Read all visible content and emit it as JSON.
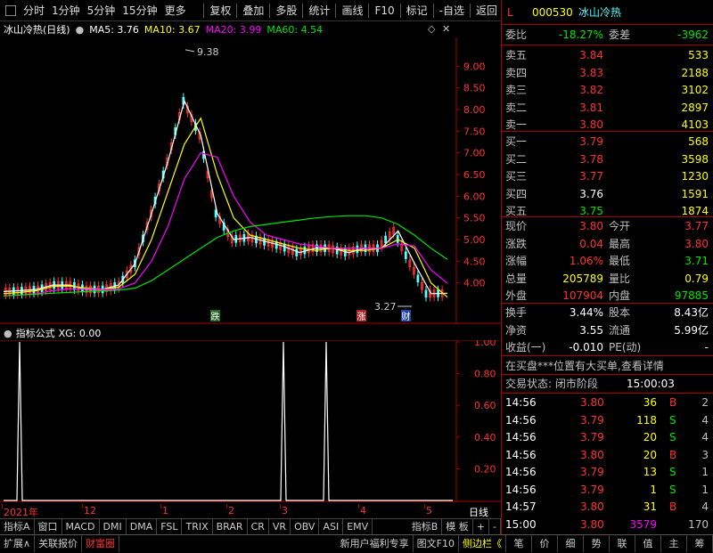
{
  "toolbar": {
    "left": [
      "分时",
      "1分钟",
      "5分钟",
      "15分钟",
      "更多"
    ],
    "right": [
      "复权",
      "叠加",
      "多股",
      "统计",
      "画线",
      "F10",
      "标记",
      "-自选",
      "返回"
    ]
  },
  "chart": {
    "title": "冰山冷热(日线)",
    "ma5_label": "MA5: 3.76",
    "ma10_label": "MA10: 3.67",
    "ma20_label": "MA20: 3.99",
    "ma60_label": "MA60: 4.54",
    "high_label": "9.38",
    "low_label": "3.27",
    "y_ticks": [
      "9.00",
      "8.50",
      "8.00",
      "7.50",
      "7.00",
      "6.50",
      "6.00",
      "5.50",
      "5.00",
      "4.50",
      "4.00"
    ],
    "marker_die": "跌",
    "marker_zhang": "涨",
    "marker_cai": "财",
    "colors": {
      "ma5": "#ffffff",
      "ma10": "#ffff00",
      "ma20": "#ff00ff",
      "ma60": "#00e600",
      "up": "#ff3232",
      "down": "#54ffff"
    }
  },
  "chart_data": {
    "type": "line",
    "title": "冰山冷热(日线)",
    "y_axis_range": [
      3.5,
      9.5
    ],
    "x_ticks": [
      "2021年",
      "12",
      "1",
      "2",
      "3",
      "4",
      "5"
    ],
    "series": [
      {
        "name": "MA5",
        "values": [
          3.8,
          3.82,
          3.85,
          3.95,
          3.95,
          3.85,
          3.85,
          3.95,
          4.45,
          5.6,
          6.8,
          8.2,
          7.4,
          5.6,
          5.0,
          5.05,
          4.95,
          4.85,
          4.7,
          4.8,
          4.8,
          4.7,
          4.8,
          4.8,
          5.2,
          4.45,
          3.75,
          3.76
        ]
      },
      {
        "name": "MA10",
        "values": [
          3.75,
          3.78,
          3.82,
          3.92,
          3.93,
          3.88,
          3.85,
          3.9,
          4.2,
          5.0,
          6.1,
          7.2,
          7.8,
          6.5,
          5.5,
          5.1,
          5.0,
          4.9,
          4.8,
          4.75,
          4.8,
          4.75,
          4.75,
          4.8,
          5.0,
          4.8,
          4.0,
          3.67
        ]
      },
      {
        "name": "MA20",
        "values": [
          3.7,
          3.72,
          3.75,
          3.82,
          3.86,
          3.86,
          3.85,
          3.86,
          4.0,
          4.5,
          5.3,
          6.4,
          7.0,
          6.9,
          6.0,
          5.4,
          5.1,
          5.0,
          4.9,
          4.85,
          4.8,
          4.8,
          4.8,
          4.8,
          4.9,
          4.85,
          4.3,
          3.99
        ]
      },
      {
        "name": "MA60",
        "values": [
          3.7,
          3.72,
          3.74,
          3.76,
          3.78,
          3.8,
          3.82,
          3.83,
          3.88,
          4.05,
          4.3,
          4.55,
          4.8,
          5.05,
          5.2,
          5.3,
          5.35,
          5.4,
          5.45,
          5.5,
          5.53,
          5.55,
          5.55,
          5.5,
          5.35,
          5.1,
          4.8,
          4.54
        ]
      }
    ]
  },
  "indicator": {
    "title": "指标公式",
    "xg_label": "XG: 0.00",
    "y_ticks": [
      "1.00",
      "0.80",
      "0.60",
      "0.40",
      "0.20"
    ]
  },
  "indicator_data": {
    "type": "line",
    "y_axis_range": [
      0,
      1
    ],
    "signals": [
      0,
      1,
      0,
      0,
      0,
      0,
      0,
      0,
      0,
      0,
      0,
      0,
      0,
      0,
      0,
      0,
      0,
      0,
      0,
      0,
      1,
      0,
      1,
      0,
      0,
      0,
      0,
      0
    ]
  },
  "xaxis": {
    "labels": [
      "2021年",
      "12",
      "1",
      "2",
      "3",
      "4",
      "5"
    ],
    "right": "日线"
  },
  "tabs": [
    "指标A",
    "窗口",
    "MACD",
    "DMI",
    "DMA",
    "FSL",
    "TRIX",
    "BRAR",
    "CR",
    "VR",
    "OBV",
    "ASI",
    "EMV",
    "指标B",
    "模 板",
    "+",
    "-"
  ],
  "bottombar": {
    "left": [
      "扩展∧",
      "关联报价",
      "财富圈"
    ],
    "mid": [
      "新用户福利专享",
      "图文F10",
      "侧边栏《"
    ],
    "right": [
      "笔",
      "价",
      "细",
      "势",
      "联",
      "值",
      "主",
      "筹"
    ]
  },
  "quote": {
    "mark": "L",
    "code": "000530",
    "name": "冰山冷热",
    "weibi_label": "委比",
    "weibi": "-18.27%",
    "weicha_label": "委差",
    "weicha": "-3962",
    "asks": [
      {
        "label": "卖五",
        "price": "3.84",
        "vol": "533"
      },
      {
        "label": "卖四",
        "price": "3.83",
        "vol": "2188"
      },
      {
        "label": "卖三",
        "price": "3.82",
        "vol": "3102"
      },
      {
        "label": "卖二",
        "price": "3.81",
        "vol": "2897"
      },
      {
        "label": "卖一",
        "price": "3.80",
        "vol": "4103"
      }
    ],
    "bids": [
      {
        "label": "买一",
        "price": "3.79",
        "vol": "568"
      },
      {
        "label": "买二",
        "price": "3.78",
        "vol": "3598"
      },
      {
        "label": "买三",
        "price": "3.77",
        "vol": "1230"
      },
      {
        "label": "买四",
        "price": "3.76",
        "vol": "1591"
      },
      {
        "label": "买五",
        "price": "3.75",
        "vol": "1874"
      }
    ],
    "stats": [
      {
        "l1": "现价",
        "v1": "3.80",
        "c1": "red",
        "l2": "今开",
        "v2": "3.77",
        "c2": "red"
      },
      {
        "l1": "涨跌",
        "v1": "0.04",
        "c1": "red",
        "l2": "最高",
        "v2": "3.80",
        "c2": "red"
      },
      {
        "l1": "涨幅",
        "v1": "1.06%",
        "c1": "red",
        "l2": "最低",
        "v2": "3.71",
        "c2": "green"
      },
      {
        "l1": "总量",
        "v1": "205789",
        "c1": "yellow",
        "l2": "量比",
        "v2": "0.79",
        "c2": "yellow"
      },
      {
        "l1": "外盘",
        "v1": "107904",
        "c1": "red",
        "l2": "内盘",
        "v2": "97885",
        "c2": "green"
      }
    ],
    "fund": [
      {
        "l1": "换手",
        "v1": "3.44%",
        "l2": "股本",
        "v2": "8.43亿"
      },
      {
        "l1": "净资",
        "v1": "3.55",
        "l2": "流通",
        "v2": "5.99亿"
      },
      {
        "l1": "收益(一)",
        "v1": "-0.010",
        "l2": "PE(动)",
        "v2": "-"
      }
    ],
    "notice": "在买盘***位置有大买单,查看详情",
    "status_label": "交易状态: 闭市阶段",
    "status_time": "15:00:03",
    "trades": [
      {
        "time": "14:56",
        "price": "3.80",
        "pc": "red",
        "vol": "36",
        "bs": "B",
        "bc": "red",
        "n": "2"
      },
      {
        "time": "14:56",
        "price": "3.79",
        "pc": "red",
        "vol": "118",
        "bs": "S",
        "bc": "green",
        "n": "4"
      },
      {
        "time": "14:56",
        "price": "3.79",
        "pc": "red",
        "vol": "20",
        "bs": "S",
        "bc": "green",
        "n": "4"
      },
      {
        "time": "14:56",
        "price": "3.80",
        "pc": "red",
        "vol": "20",
        "bs": "B",
        "bc": "red",
        "n": "3"
      },
      {
        "time": "14:56",
        "price": "3.79",
        "pc": "red",
        "vol": "13",
        "bs": "S",
        "bc": "green",
        "n": "1"
      },
      {
        "time": "14:56",
        "price": "3.79",
        "pc": "red",
        "vol": "1",
        "bs": "S",
        "bc": "green",
        "n": "1"
      },
      {
        "time": "14:57",
        "price": "3.80",
        "pc": "red",
        "vol": "31",
        "bs": "B",
        "bc": "red",
        "n": "4"
      },
      {
        "time": "15:00",
        "price": "3.80",
        "pc": "red",
        "vol": "3579",
        "bs": "",
        "bc": "purple",
        "n": "170"
      }
    ]
  }
}
